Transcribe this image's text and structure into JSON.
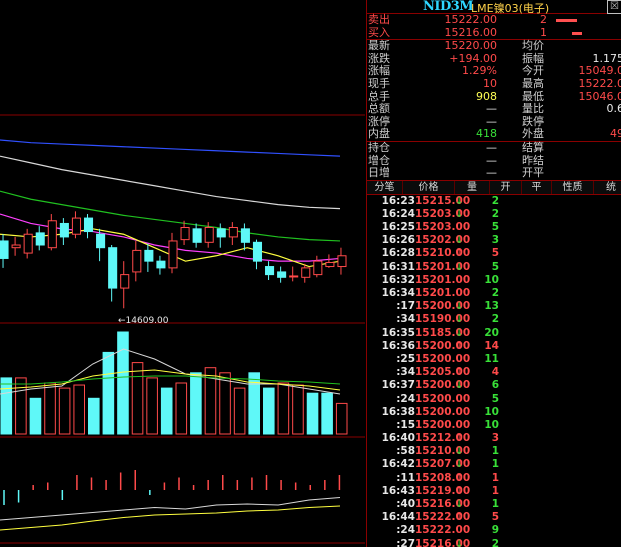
{
  "header": {
    "code": "NID3M",
    "name": "LME镍03(电子)",
    "close_glyph": "☒"
  },
  "quote": {
    "sell": {
      "label": "卖出",
      "price": "15222.00",
      "qty": "2",
      "bar": 0.8
    },
    "buy": {
      "label": "买入",
      "price": "15216.00",
      "qty": "1",
      "bar": 0.4
    },
    "rows": [
      {
        "l": "最新",
        "v": "15220.00",
        "vc": "red",
        "l2": "均价",
        "v2": "",
        "v2c": "wht"
      },
      {
        "l": "涨跌",
        "v": "+194.00",
        "vc": "red",
        "l2": "振幅",
        "v2": "1.175",
        "v2c": "wht"
      },
      {
        "l": "涨幅",
        "v": "1.29%",
        "vc": "red",
        "l2": "今开",
        "v2": "15049.0",
        "v2c": "red"
      },
      {
        "l": "现手",
        "v": "10",
        "vc": "red",
        "l2": "最高",
        "v2": "15222.0",
        "v2c": "red"
      },
      {
        "l": "总手",
        "v": "908",
        "vc": "yel",
        "l2": "最低",
        "v2": "15046.0",
        "v2c": "red"
      },
      {
        "l": "总额",
        "v": "—",
        "vc": "wht",
        "l2": "量比",
        "v2": "0.6",
        "v2c": "wht"
      },
      {
        "l": "涨停",
        "v": "—",
        "vc": "wht",
        "l2": "跌停",
        "v2": "",
        "v2c": "wht"
      },
      {
        "l": "内盘",
        "v": "418",
        "vc": "grn",
        "l2": "外盘",
        "v2": "49",
        "v2c": "red"
      }
    ],
    "rows2": [
      {
        "l": "持仓",
        "v": "—",
        "l2": "结算"
      },
      {
        "l": "增仓",
        "v": "—",
        "l2": "昨结"
      },
      {
        "l": "日增",
        "v": "—",
        "l2": "开平"
      }
    ]
  },
  "tabs": [
    "分笔",
    "价格",
    "量",
    "开",
    "平",
    "性质",
    "统"
  ],
  "ticks": [
    {
      "t": "16:23",
      "p": "15215.00",
      "a": "down",
      "v": "2"
    },
    {
      "t": "16:24",
      "p": "15203.00",
      "a": "down",
      "v": "2"
    },
    {
      "t": "16:25",
      "p": "15203.00",
      "a": "",
      "v": "5"
    },
    {
      "t": "16:26",
      "p": "15202.00",
      "a": "down",
      "v": "3"
    },
    {
      "t": "16:28",
      "p": "15210.00",
      "a": "up",
      "v": "5"
    },
    {
      "t": "16:31",
      "p": "15201.00",
      "a": "down",
      "v": "5"
    },
    {
      "t": "16:32",
      "p": "15201.00",
      "a": "",
      "v": "10"
    },
    {
      "t": "16:34",
      "p": "15201.00",
      "a": "",
      "v": "2"
    },
    {
      "t": ":17",
      "p": "15200.00",
      "a": "down",
      "v": "13"
    },
    {
      "t": ":34",
      "p": "15190.00",
      "a": "down",
      "v": "2"
    },
    {
      "t": "16:35",
      "p": "15185.00",
      "a": "down",
      "v": "20"
    },
    {
      "t": "16:36",
      "p": "15200.00",
      "a": "up",
      "v": "14"
    },
    {
      "t": ":25",
      "p": "15200.00",
      "a": "",
      "v": "11"
    },
    {
      "t": ":34",
      "p": "15205.00",
      "a": "up",
      "v": "4"
    },
    {
      "t": "16:37",
      "p": "15200.00",
      "a": "down",
      "v": "6"
    },
    {
      "t": ":24",
      "p": "15200.00",
      "a": "",
      "v": "5"
    },
    {
      "t": "16:38",
      "p": "15200.00",
      "a": "",
      "v": "10"
    },
    {
      "t": ":15",
      "p": "15200.00",
      "a": "",
      "v": "10"
    },
    {
      "t": "16:40",
      "p": "15212.00",
      "a": "up",
      "v": "3"
    },
    {
      "t": ":58",
      "p": "15210.00",
      "a": "down",
      "v": "1"
    },
    {
      "t": "16:42",
      "p": "15207.00",
      "a": "down",
      "v": "1"
    },
    {
      "t": ":11",
      "p": "15208.00",
      "a": "up",
      "v": "1"
    },
    {
      "t": "16:43",
      "p": "15219.00",
      "a": "up",
      "v": "1"
    },
    {
      "t": ":40",
      "p": "15216.00",
      "a": "down",
      "v": "1"
    },
    {
      "t": "16:44",
      "p": "15222.00",
      "a": "up",
      "v": "5"
    },
    {
      "t": ":24",
      "p": "15222.00",
      "a": "",
      "v": "9"
    },
    {
      "t": ":27",
      "p": "15216.00",
      "a": "down",
      "v": "2"
    }
  ],
  "colors": {
    "up": "#ff4a4a",
    "down": "#38e038",
    "even": "#e8e8e8",
    "cyan": "#5ff8f8",
    "grid": "#8a0000"
  },
  "chart_data": {
    "type": "candlestick",
    "annotation": "←14609.00",
    "candles": [
      [
        0.25,
        0.12,
        0.3,
        0.05
      ],
      [
        0.2,
        0.22,
        0.28,
        0.14
      ],
      [
        0.16,
        0.3,
        0.34,
        0.12
      ],
      [
        0.31,
        0.22,
        0.36,
        0.18
      ],
      [
        0.2,
        0.4,
        0.45,
        0.18
      ],
      [
        0.38,
        0.28,
        0.42,
        0.22
      ],
      [
        0.3,
        0.42,
        0.47,
        0.27
      ],
      [
        0.42,
        0.32,
        0.45,
        0.27
      ],
      [
        0.3,
        0.2,
        0.34,
        0.1
      ],
      [
        0.2,
        -0.1,
        0.22,
        -0.2
      ],
      [
        -0.1,
        0.0,
        0.1,
        -0.25
      ],
      [
        0.02,
        0.18,
        0.25,
        -0.05
      ],
      [
        0.18,
        0.1,
        0.23,
        0.02
      ],
      [
        0.1,
        0.05,
        0.14,
        0.0
      ],
      [
        0.05,
        0.25,
        0.31,
        0.01
      ],
      [
        0.26,
        0.35,
        0.4,
        0.22
      ],
      [
        0.34,
        0.24,
        0.38,
        0.2
      ],
      [
        0.24,
        0.35,
        0.39,
        0.2
      ],
      [
        0.34,
        0.28,
        0.38,
        0.2
      ],
      [
        0.28,
        0.35,
        0.39,
        0.22
      ],
      [
        0.34,
        0.24,
        0.38,
        0.18
      ],
      [
        0.24,
        0.1,
        0.26,
        0.04
      ],
      [
        0.06,
        0.0,
        0.1,
        -0.04
      ],
      [
        0.02,
        -0.02,
        0.06,
        -0.06
      ],
      [
        -0.01,
        -0.01,
        0.06,
        -0.05
      ],
      [
        -0.02,
        0.05,
        0.08,
        -0.06
      ],
      [
        0.0,
        0.1,
        0.14,
        -0.02
      ],
      [
        0.06,
        0.09,
        0.15,
        0.05
      ],
      [
        0.06,
        0.14,
        0.2,
        0.0
      ]
    ],
    "ma_lines": [
      {
        "color": "#3050ff",
        "values": [
          1.0,
          0.98,
          0.97,
          0.96,
          0.95,
          0.94,
          0.93,
          0.92,
          0.91,
          0.9,
          0.89,
          0.88
        ]
      },
      {
        "color": "#d8d8d8",
        "values": [
          0.88,
          0.83,
          0.78,
          0.74,
          0.7,
          0.66,
          0.62,
          0.58,
          0.55,
          0.52,
          0.5,
          0.49
        ]
      },
      {
        "color": "#20c020",
        "values": [
          0.62,
          0.56,
          0.52,
          0.48,
          0.44,
          0.41,
          0.38,
          0.35,
          0.31,
          0.28,
          0.26,
          0.25
        ]
      },
      {
        "color": "#ff40ff",
        "values": [
          0.45,
          0.38,
          0.34,
          0.32,
          0.28,
          0.22,
          0.18,
          0.16,
          0.12,
          0.1,
          0.1,
          0.12
        ]
      },
      {
        "color": "#ffff40",
        "values": [
          0.3,
          0.28,
          0.3,
          0.34,
          0.3,
          0.2,
          0.1,
          0.14,
          0.2,
          0.14,
          0.06,
          0.1
        ]
      }
    ],
    "volume": [
      {
        "v": 0.55,
        "d": "down"
      },
      {
        "v": 0.55,
        "d": "up"
      },
      {
        "v": 0.35,
        "d": "down"
      },
      {
        "v": 0.5,
        "d": "up"
      },
      {
        "v": 0.45,
        "d": "up"
      },
      {
        "v": 0.48,
        "d": "up"
      },
      {
        "v": 0.35,
        "d": "down"
      },
      {
        "v": 0.8,
        "d": "down"
      },
      {
        "v": 1.0,
        "d": "down"
      },
      {
        "v": 0.7,
        "d": "up"
      },
      {
        "v": 0.55,
        "d": "up"
      },
      {
        "v": 0.45,
        "d": "down"
      },
      {
        "v": 0.5,
        "d": "up"
      },
      {
        "v": 0.6,
        "d": "down"
      },
      {
        "v": 0.65,
        "d": "up"
      },
      {
        "v": 0.6,
        "d": "up"
      },
      {
        "v": 0.45,
        "d": "up"
      },
      {
        "v": 0.6,
        "d": "down"
      },
      {
        "v": 0.45,
        "d": "down"
      },
      {
        "v": 0.5,
        "d": "up"
      },
      {
        "v": 0.48,
        "d": "up"
      },
      {
        "v": 0.4,
        "d": "down"
      },
      {
        "v": 0.4,
        "d": "down"
      },
      {
        "v": 0.3,
        "d": "up"
      }
    ],
    "volume_ma": [
      {
        "color": "#d8d8d8",
        "values": [
          0.4,
          0.45,
          0.48,
          0.7,
          0.85,
          0.75,
          0.6,
          0.55,
          0.5,
          0.5,
          0.45,
          0.4
        ]
      },
      {
        "color": "#ffff40",
        "values": [
          0.45,
          0.47,
          0.5,
          0.58,
          0.62,
          0.64,
          0.6,
          0.58,
          0.52,
          0.5,
          0.48,
          0.44
        ]
      },
      {
        "color": "#20c020",
        "values": [
          0.5,
          0.5,
          0.52,
          0.55,
          0.57,
          0.58,
          0.58,
          0.56,
          0.55,
          0.53,
          0.52,
          0.5
        ]
      }
    ],
    "macd": [
      -0.3,
      -0.25,
      0.1,
      0.15,
      -0.2,
      0.3,
      0.25,
      0.2,
      0.35,
      0.4,
      -0.1,
      0.15,
      0.25,
      0.1,
      0.2,
      0.3,
      0.2,
      0.25,
      0.3,
      0.2,
      0.15,
      0.1,
      0.2,
      0.3
    ],
    "macd_lines": [
      {
        "color": "#d8d8d8",
        "values": [
          -0.6,
          -0.55,
          -0.5,
          -0.45,
          -0.4,
          -0.35,
          -0.38,
          -0.3,
          -0.28,
          -0.3,
          -0.2,
          -0.15
        ]
      },
      {
        "color": "#ffff40",
        "values": [
          -0.8,
          -0.75,
          -0.7,
          -0.62,
          -0.55,
          -0.5,
          -0.48,
          -0.46,
          -0.42,
          -0.4,
          -0.35,
          -0.32
        ]
      }
    ]
  }
}
